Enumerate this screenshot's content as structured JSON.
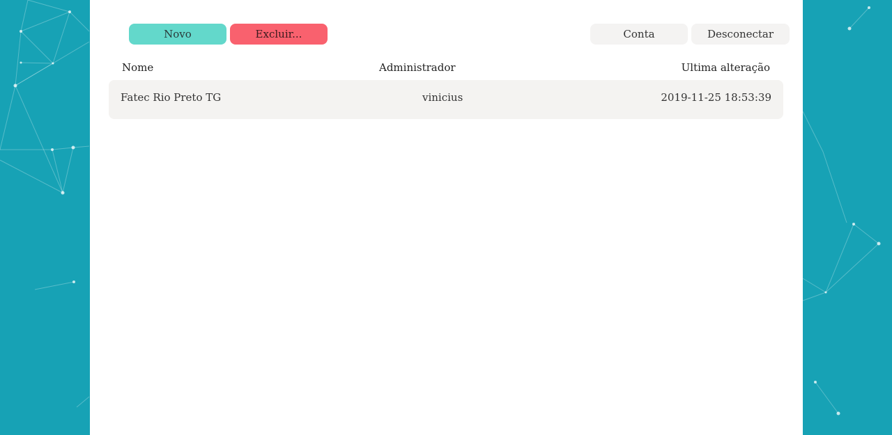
{
  "colors": {
    "background": "#17a2b5",
    "panel": "#ffffff",
    "primary_button": "#63d8cb",
    "danger_button": "#f9616e",
    "neutral_button": "#f4f3f2"
  },
  "toolbar": {
    "new_label": "Novo",
    "delete_label": "Excluir...",
    "account_label": "Conta",
    "logout_label": "Desconectar"
  },
  "table": {
    "headers": [
      "Nome",
      "Administrador",
      "Ultima alteração"
    ],
    "rows": [
      {
        "nome": "Fatec Rio Preto TG",
        "administrador": "vinicius",
        "ultima_alteracao": "2019-11-25 18:53:39"
      }
    ]
  }
}
